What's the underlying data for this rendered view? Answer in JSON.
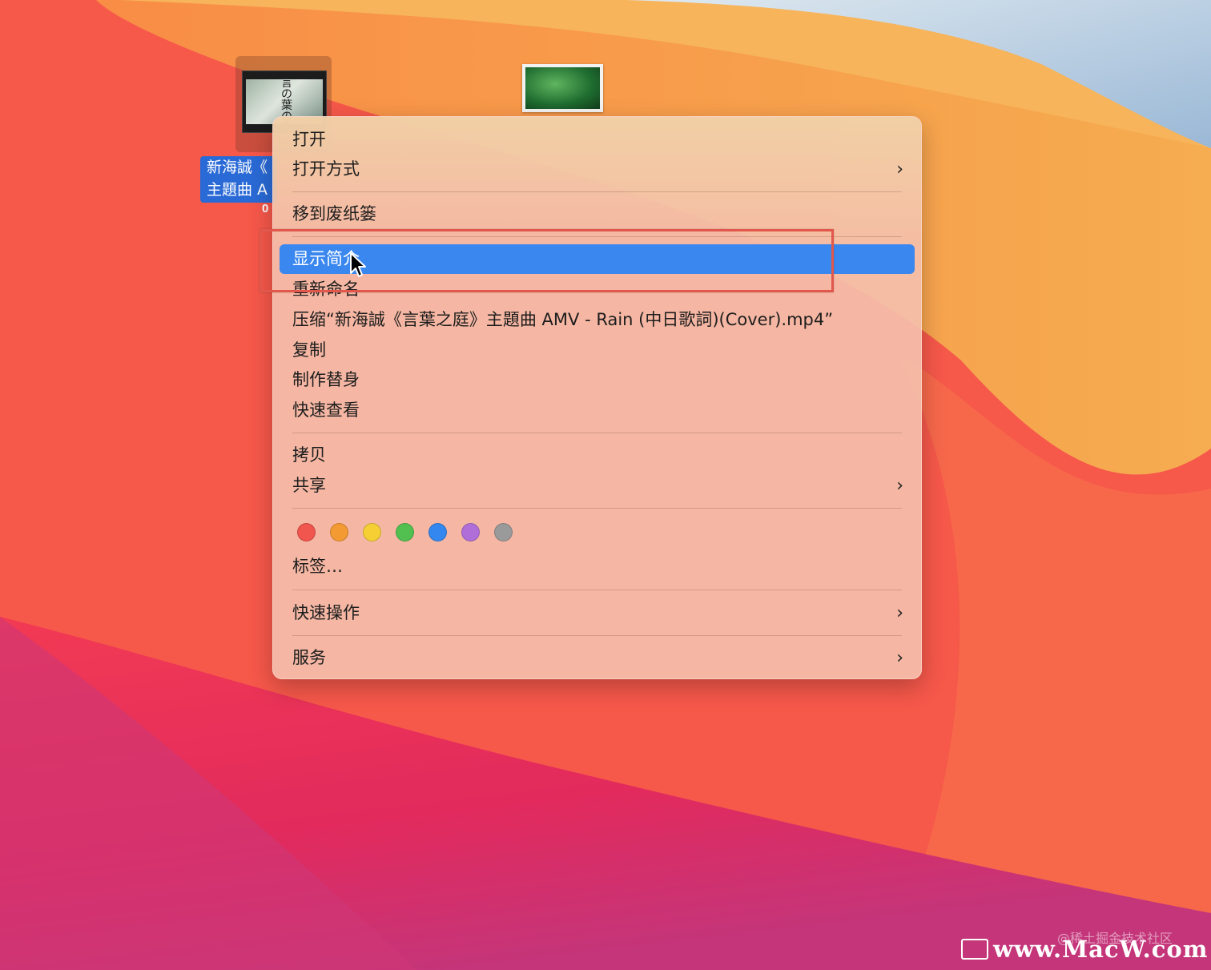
{
  "desktop": {
    "video_file": {
      "label_line1": "新海誠《",
      "label_line2": "主題曲 A",
      "sub_label": "0",
      "thumb_text": "言の葉の庭"
    },
    "image_file": {}
  },
  "menu": {
    "open": "打开",
    "open_with": "打开方式",
    "move_to_trash": "移到废纸篓",
    "get_info": "显示简介",
    "rename": "重新命名",
    "compress": "压缩“新海誠《言葉之庭》主題曲 AMV - Rain (中日歌詞)(Cover).mp4”",
    "duplicate": "复制",
    "make_alias": "制作替身",
    "quick_look": "快速查看",
    "copy": "拷贝",
    "share": "共享",
    "tags": "标签…",
    "quick_actions": "快速操作",
    "services": "服务",
    "submenu_arrow": "›",
    "tag_colors": [
      "#f0554e",
      "#f39a33",
      "#f6cf35",
      "#52c050",
      "#3487ee",
      "#b06fd8",
      "#9a9a9a"
    ]
  },
  "watermark": {
    "site": "www.MacW.com",
    "community": "@稀土掘金技术社区"
  }
}
